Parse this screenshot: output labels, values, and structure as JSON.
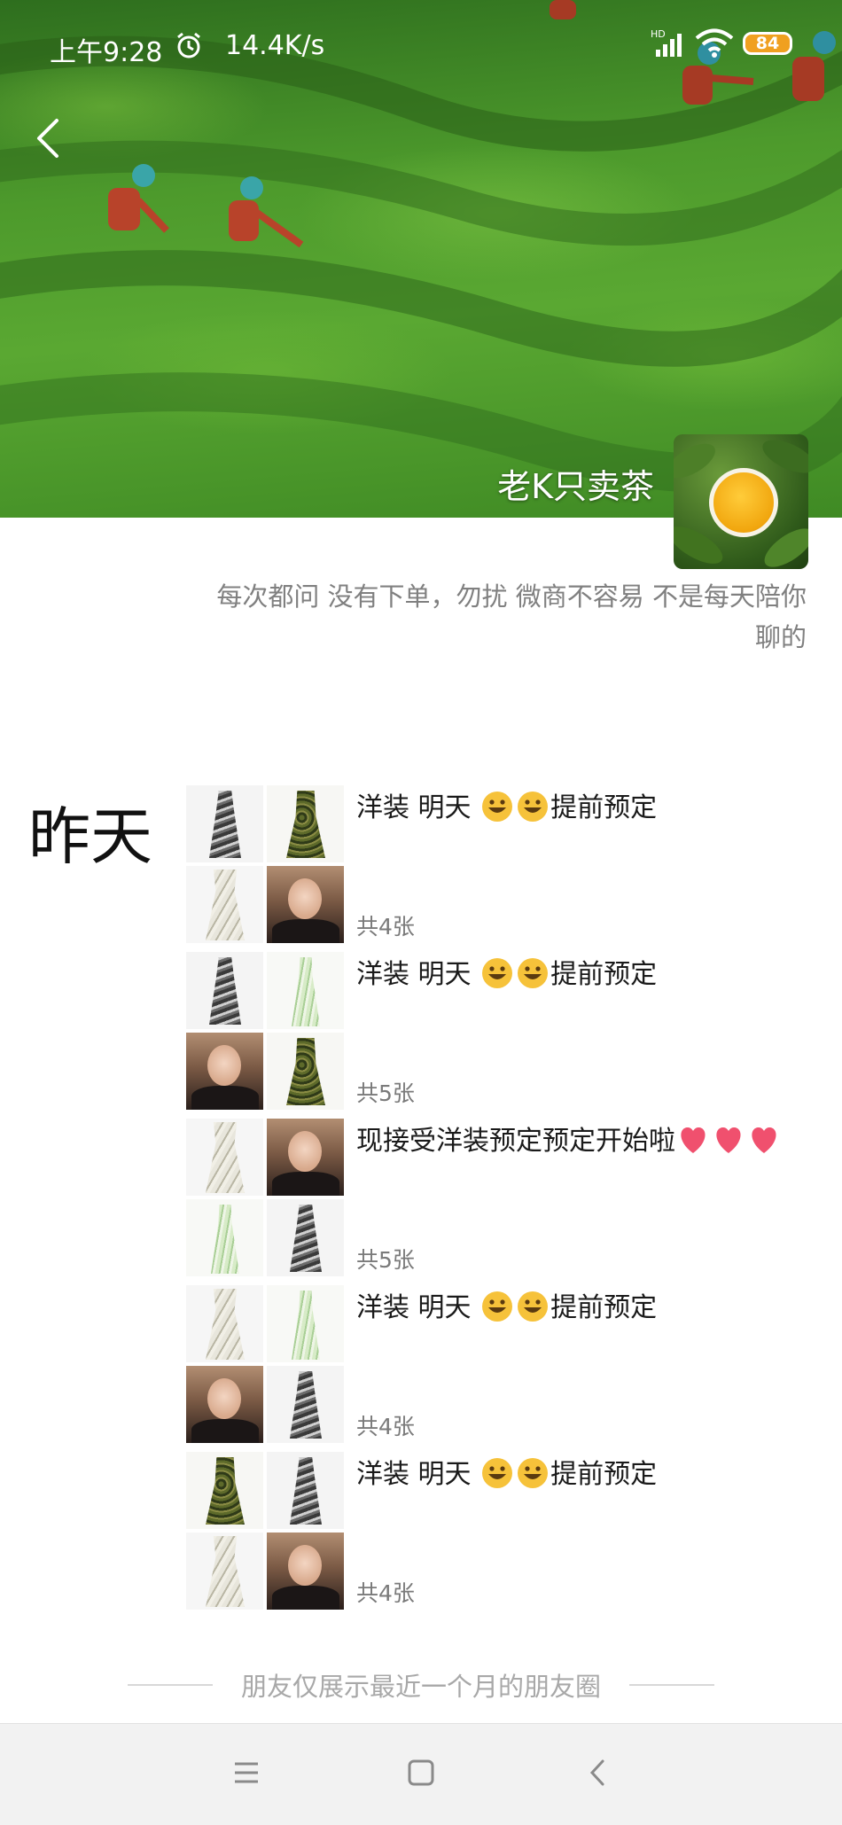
{
  "status_bar": {
    "time": "上午9:28",
    "network_speed": "14.4K/s",
    "battery": "84",
    "icons": [
      "alarm-icon",
      "signal-icon",
      "wifi-icon",
      "battery-icon"
    ]
  },
  "header": {
    "back_icon": "chevron-left-icon",
    "owner_name": "老K只卖茶",
    "signature": "每次都问 没有下单，勿扰 微商不容易 不是每天陪你聊的"
  },
  "feed": {
    "day_label": "昨天",
    "posts": [
      {
        "text_before": "洋装 明天 ",
        "text_after": "提前预定",
        "emoji": [
          "😀",
          "😀"
        ],
        "count": "共4张",
        "images": [
          "dress-bw",
          "dress-green",
          "dress-white",
          "portrait"
        ]
      },
      {
        "text_before": "洋装 明天 ",
        "text_after": "提前预定",
        "emoji": [
          "😀",
          "😀"
        ],
        "count": "共5张",
        "images": [
          "dress-bw",
          "dress-mint",
          "portrait",
          "dress-green"
        ]
      },
      {
        "text_before": "现接受洋装预定预定开始啦",
        "text_after": "",
        "emoji": [
          "❤",
          "❤",
          "❤"
        ],
        "count": "共5张",
        "images": [
          "dress-white",
          "portrait",
          "dress-mint",
          "dress-bw"
        ]
      },
      {
        "text_before": "洋装 明天 ",
        "text_after": "提前预定",
        "emoji": [
          "😀",
          "😀"
        ],
        "count": "共4张",
        "images": [
          "dress-white",
          "dress-mint",
          "portrait",
          "dress-bw"
        ]
      },
      {
        "text_before": "洋装 明天 ",
        "text_after": "提前预定",
        "emoji": [
          "😀",
          "😀"
        ],
        "count": "共4张",
        "images": [
          "dress-green",
          "dress-bw",
          "dress-white",
          "portrait"
        ]
      }
    ]
  },
  "footer": {
    "note": "朋友仅展示最近一个月的朋友圈"
  },
  "nav_bar": {
    "icons": [
      "menu-icon",
      "home-square-icon",
      "back-triangle-icon"
    ]
  },
  "colors": {
    "accent_battery": "#f0a020",
    "heart": "#f0506e",
    "emoji_face": "#f6c23a"
  }
}
